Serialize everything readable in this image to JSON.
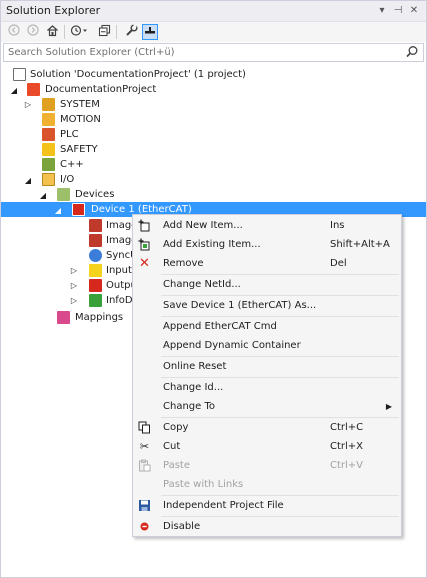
{
  "window": {
    "title": "Solution Explorer",
    "pin_glyph": "⊣",
    "close_glyph": "✕",
    "dropdown_glyph": "▾"
  },
  "toolbar": {
    "back_glyph": "◀",
    "forward_glyph": "▶",
    "home_glyph": "⌂",
    "history_glyph": "◷",
    "history_arrow": "▾",
    "pages_glyph": "❐",
    "properties_glyph": "🔧",
    "preview_glyph": "▬"
  },
  "search": {
    "placeholder": "Search Solution Explorer (Ctrl+ü)"
  },
  "tree": {
    "solution": "Solution 'DocumentationProject' (1 project)",
    "project": "DocumentationProject",
    "system": "SYSTEM",
    "motion": "MOTION",
    "plc": "PLC",
    "safety": "SAFETY",
    "cpp": "C++",
    "io": "I/O",
    "devices": "Devices",
    "device1": "Device 1 (EtherCAT)",
    "image1": "Image",
    "image2": "Image",
    "syncunits": "SyncU",
    "inputs": "Input",
    "outputs": "Outpu",
    "infodata": "InfoD",
    "mappings": "Mappings",
    "expanded_arrow": "◢",
    "collapsed_arrow": "▷"
  },
  "context_menu": {
    "items": [
      {
        "label": "Add New Item...",
        "shortcut": "Ins",
        "icon": "add-new-item-icon"
      },
      {
        "label": "Add Existing Item...",
        "shortcut": "Shift+Alt+A",
        "icon": "add-existing-item-icon"
      },
      {
        "label": "Remove",
        "shortcut": "Del",
        "icon": "remove-icon"
      },
      {
        "label": "Change NetId...",
        "shortcut": ""
      },
      {
        "label": "Save Device 1 (EtherCAT) As...",
        "shortcut": ""
      },
      {
        "label": "Append EtherCAT Cmd",
        "shortcut": ""
      },
      {
        "label": "Append Dynamic Container",
        "shortcut": ""
      },
      {
        "label": "Online Reset",
        "shortcut": ""
      },
      {
        "label": "Change Id...",
        "shortcut": ""
      },
      {
        "label": "Change To",
        "shortcut": "",
        "submenu_glyph": "▶"
      },
      {
        "label": "Copy",
        "shortcut": "Ctrl+C",
        "icon": "copy-icon"
      },
      {
        "label": "Cut",
        "shortcut": "Ctrl+X",
        "icon": "cut-icon"
      },
      {
        "label": "Paste",
        "shortcut": "Ctrl+V",
        "icon": "paste-icon",
        "disabled": true
      },
      {
        "label": "Paste with Links",
        "shortcut": "",
        "disabled": true
      },
      {
        "label": "Independent Project File",
        "shortcut": "",
        "icon": "save-file-icon"
      },
      {
        "label": "Disable",
        "shortcut": "",
        "icon": "disable-icon"
      }
    ],
    "glyphs": {
      "remove": "✕",
      "copy": "❐",
      "cut": "✂",
      "paste": "📋",
      "disable": "●"
    }
  },
  "colors": {
    "selection": "#3399ff",
    "menu_bg": "#f5f5f5",
    "accent_red": "#d6281c",
    "folder_yellow": "#f2c14e"
  }
}
